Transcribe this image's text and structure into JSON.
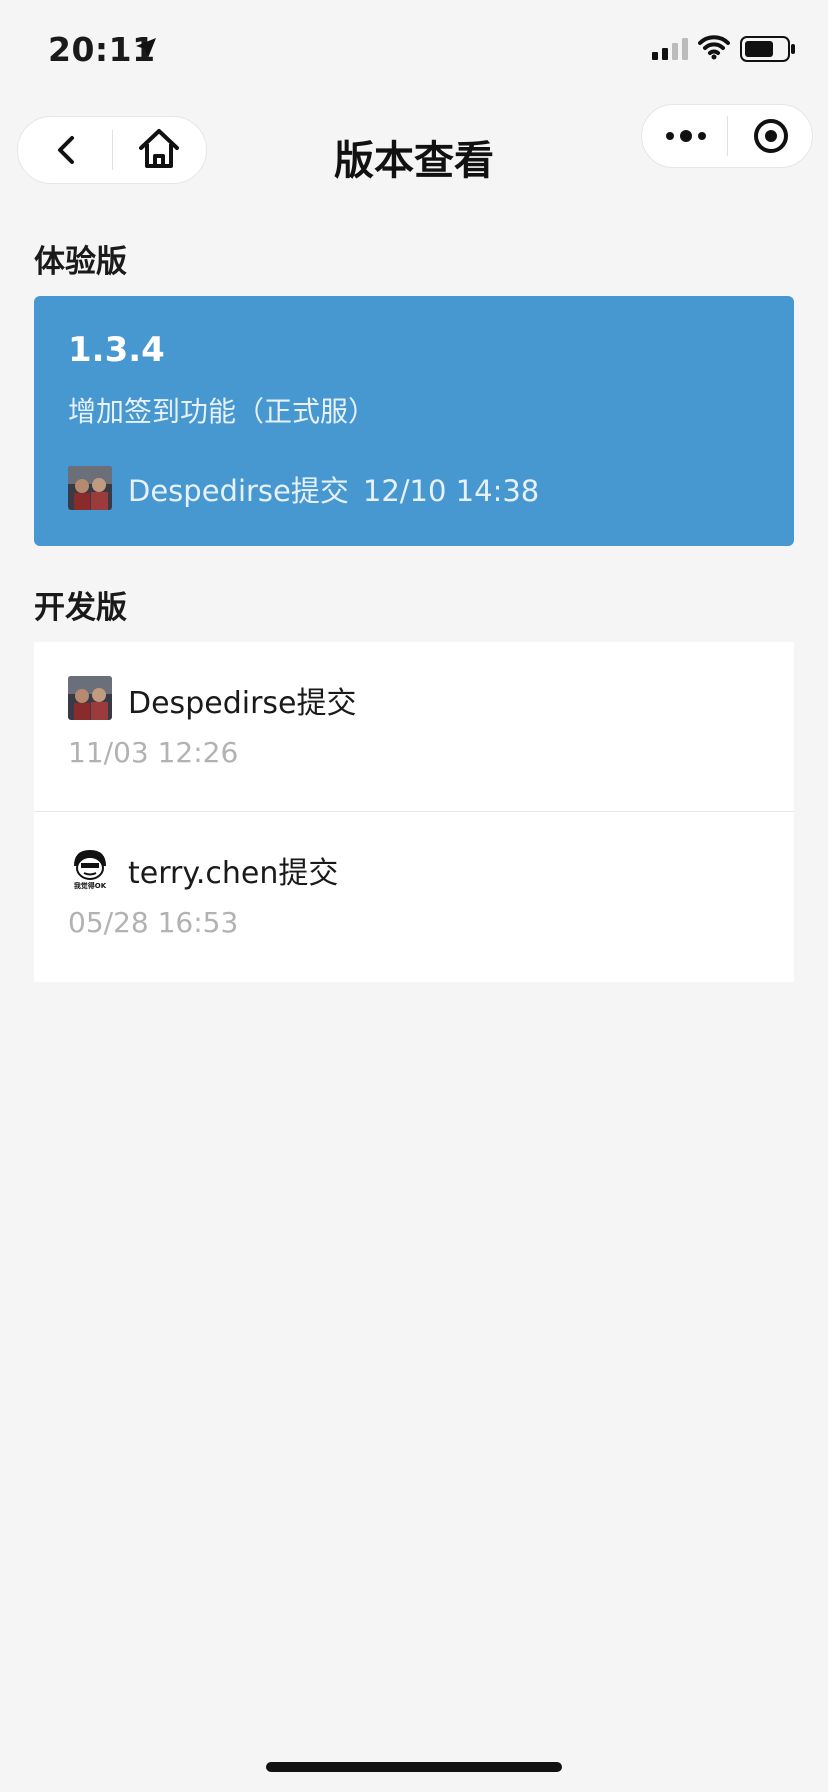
{
  "status_bar": {
    "time": "20:11",
    "icons": [
      "location-arrow-icon",
      "signal-icon",
      "wifi-icon",
      "battery-icon"
    ]
  },
  "nav": {
    "title": "版本查看",
    "back_icon": "chevron-left-icon",
    "home_icon": "home-icon",
    "more_icon": "more-dots-icon",
    "close_icon": "target-circle-icon"
  },
  "trial": {
    "section_label": "体验版",
    "version": "1.3.4",
    "description": "增加签到功能（正式服）",
    "submitter": "Despedirse提交",
    "time": "12/10 14:38",
    "card_color": "#4797d1"
  },
  "dev": {
    "section_label": "开发版",
    "items": [
      {
        "submitter": "Despedirse提交",
        "time": "11/03 12:26"
      },
      {
        "submitter": "terry.chen提交",
        "time": "05/28 16:53",
        "avatar_text": "我觉得OK"
      }
    ]
  },
  "colors": {
    "background": "#f5f5f5",
    "accent": "#4797d1",
    "muted_text": "#b2b2b2"
  }
}
